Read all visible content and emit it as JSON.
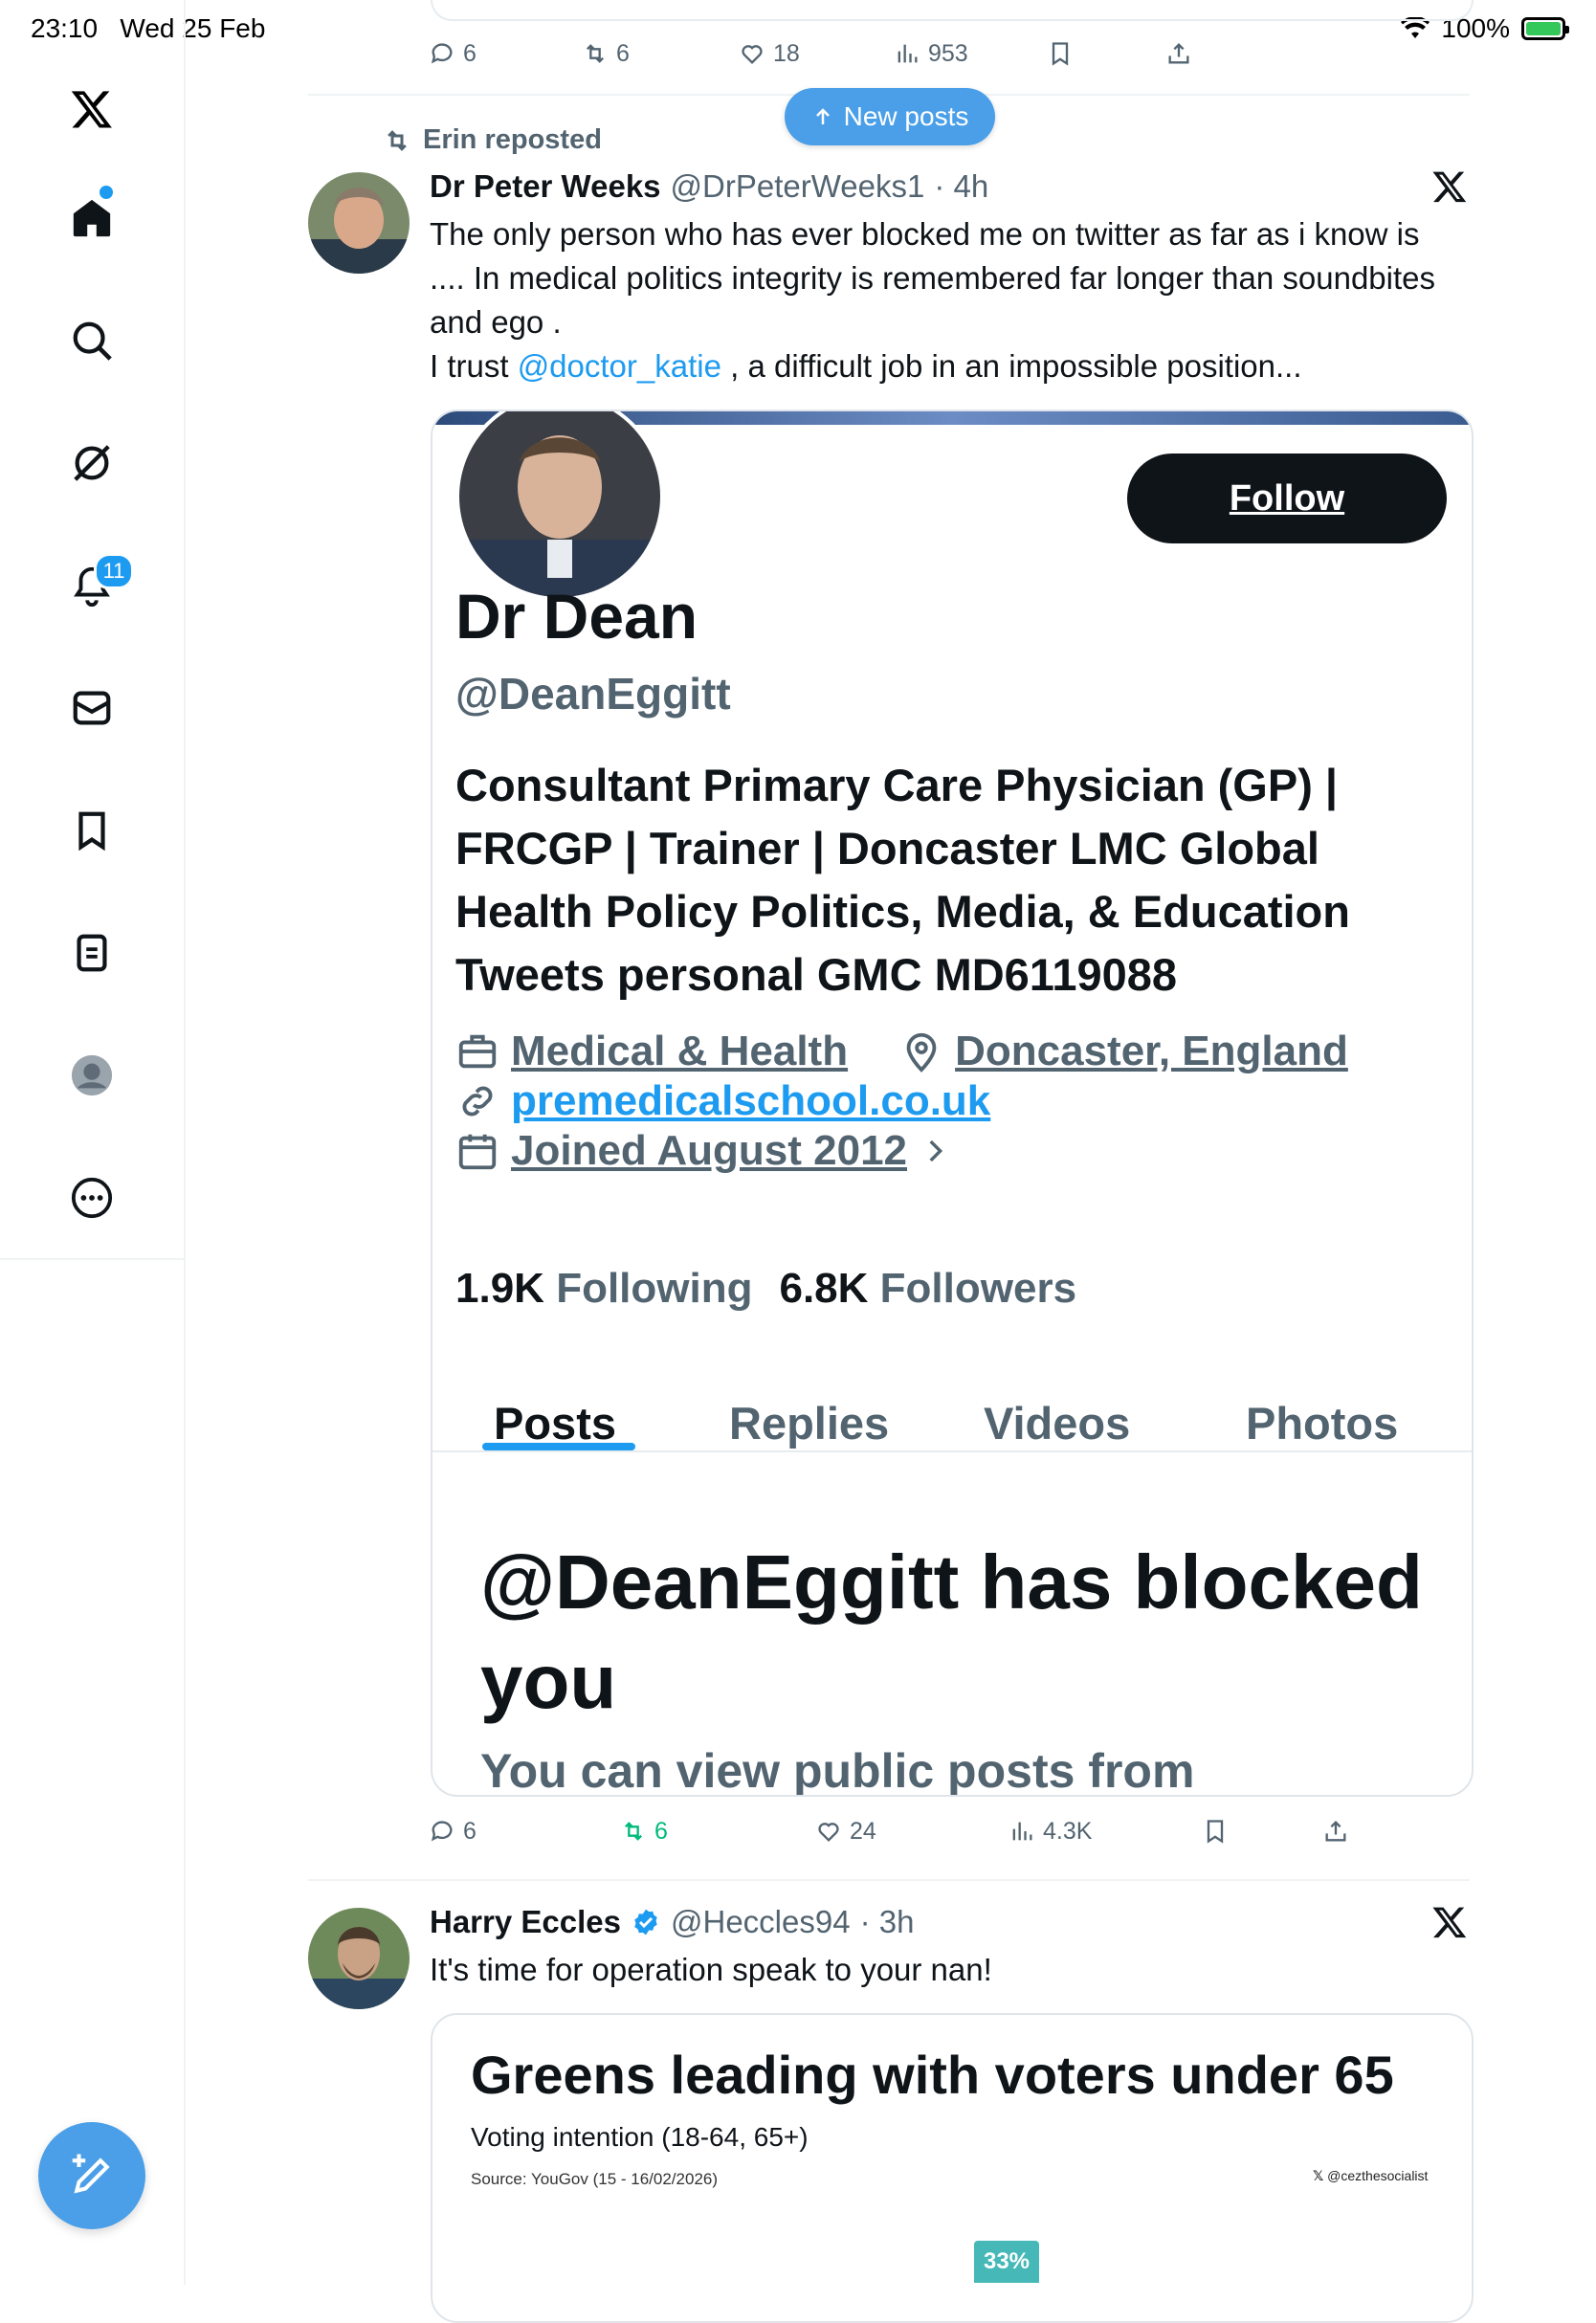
{
  "status_bar": {
    "time": "23:10",
    "date": "Wed 25 Feb",
    "battery": "100%"
  },
  "nav": {
    "notifications_badge": "11",
    "icons": [
      "x-logo-icon",
      "home-icon",
      "search-icon",
      "grok-icon",
      "bell-icon",
      "mail-icon",
      "bookmark-icon",
      "lists-icon",
      "profile-icon",
      "more-icon"
    ]
  },
  "top_tweet_actions": {
    "replies": "6",
    "reposts": "6",
    "likes": "18",
    "views": "953"
  },
  "new_posts": {
    "label": "New posts"
  },
  "tweet1": {
    "repost_label": "Erin reposted",
    "author_name": "Dr Peter Weeks",
    "author_handle": "@DrPeterWeeks1",
    "time": "· 4h",
    "text_line1": "The only person who has ever blocked me on twitter as far as i know is",
    "text_line2": ".... In medical politics integrity is remembered far longer than soundbites",
    "text_line3": "and ego .",
    "text_line4_pre": "I trust ",
    "text_line4_mention": "@doctor_katie",
    "text_line4_post": " , a difficult job in an impossible position...",
    "actions": {
      "replies": "6",
      "reposts": "6",
      "likes": "24",
      "views": "4.3K"
    }
  },
  "profile_card": {
    "follow_label": "Follow",
    "name": "Dr Dean",
    "handle": "@DeanEggitt",
    "bio_line1": "Consultant Primary Care Physician (GP) |",
    "bio_line2": "FRCGP | Trainer | Doncaster LMC Global",
    "bio_line3": "Health Policy Politics, Media, & Education",
    "bio_line4": "Tweets personal GMC MD6119088",
    "category": "Medical & Health",
    "location": "Doncaster, England",
    "website": "premedicalschool.co.uk",
    "joined": "Joined August 2012",
    "following_count": "1.9K",
    "following_label": "Following",
    "followers_count": "6.8K",
    "followers_label": "Followers",
    "tabs": [
      "Posts",
      "Replies",
      "Videos",
      "Photos"
    ],
    "blocked_title": "@DeanEggitt has blocked you",
    "blocked_sub": "You can view public posts from"
  },
  "tweet2": {
    "author_name": "Harry Eccles",
    "author_handle": "@Heccles94",
    "time": "· 3h",
    "text": "It's time for operation speak to your nan!",
    "card": {
      "title": "Greens leading with voters under 65",
      "subtitle": "Voting intention (18-64, 65+)",
      "source": "Source: YouGov (15 - 16/02/2026)",
      "credit": "@cezthesocialist",
      "first_value": "33%"
    }
  },
  "colors": {
    "accent": "#1d9bf0",
    "repost_green": "#00ba7c",
    "fab": "#4a9fe8"
  }
}
